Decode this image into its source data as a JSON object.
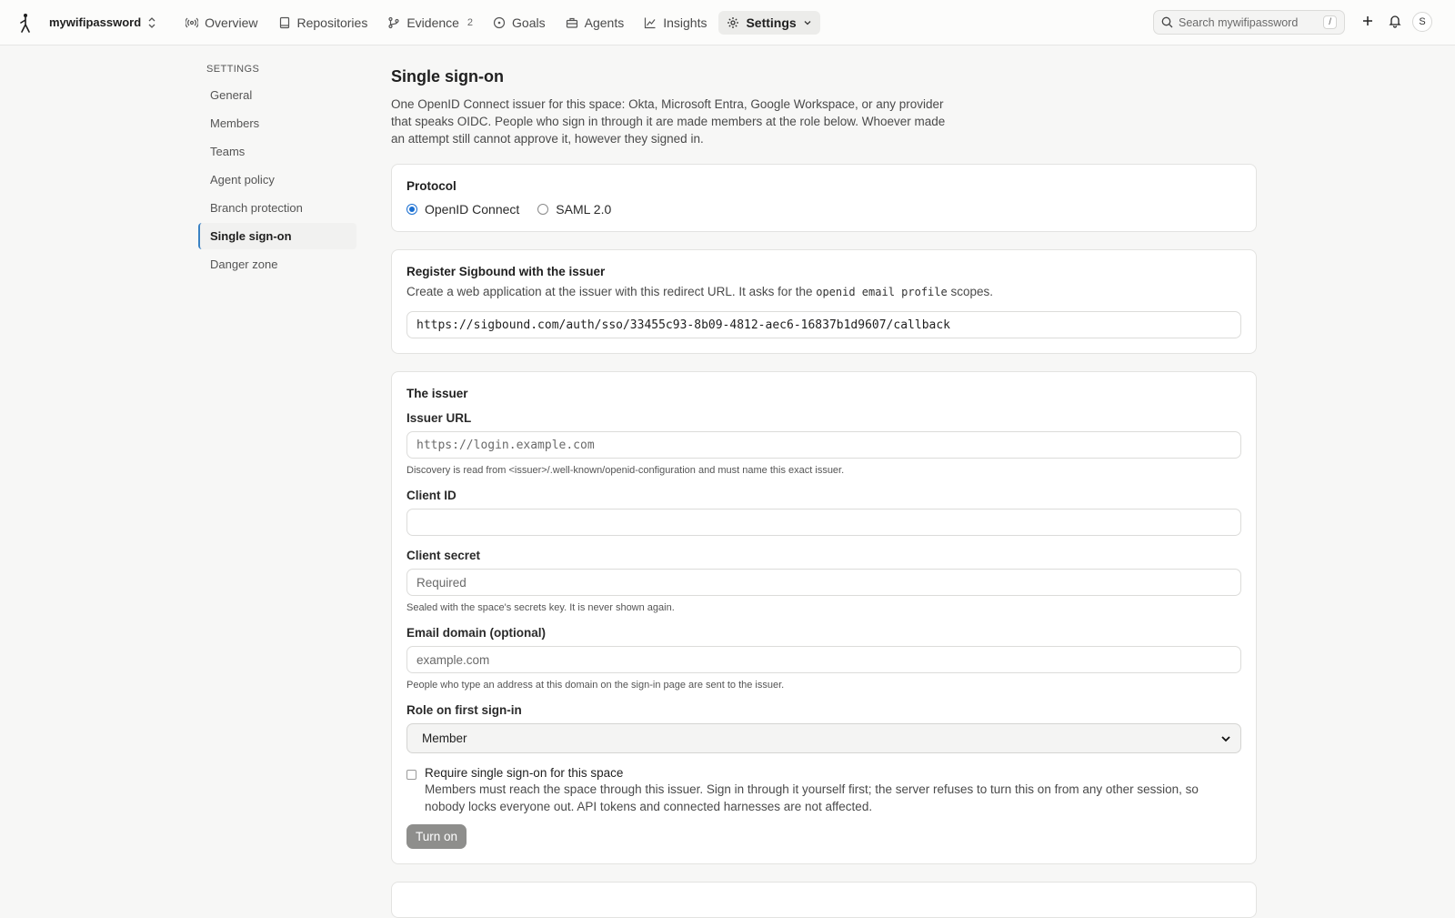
{
  "header": {
    "space_name": "mywifipassword",
    "nav": [
      {
        "label": "Overview",
        "icon": "broadcast-icon"
      },
      {
        "label": "Repositories",
        "icon": "book-icon"
      },
      {
        "label": "Evidence",
        "icon": "git-branch-icon",
        "count": "2"
      },
      {
        "label": "Goals",
        "icon": "target-icon"
      },
      {
        "label": "Agents",
        "icon": "briefcase-icon"
      },
      {
        "label": "Insights",
        "icon": "chart-line-icon"
      },
      {
        "label": "Settings",
        "icon": "gear-icon",
        "active": true
      }
    ],
    "search_placeholder": "Search mywifipassword",
    "search_shortcut": "/",
    "avatar_initial": "S"
  },
  "sidebar": {
    "heading": "Settings",
    "items": [
      {
        "label": "General"
      },
      {
        "label": "Members"
      },
      {
        "label": "Teams"
      },
      {
        "label": "Agent policy"
      },
      {
        "label": "Branch protection"
      },
      {
        "label": "Single sign-on",
        "active": true
      },
      {
        "label": "Danger zone"
      }
    ]
  },
  "main": {
    "title": "Single sign-on",
    "description": "One OpenID Connect issuer for this space: Okta, Microsoft Entra, Google Workspace, or any provider that speaks OIDC. People who sign in through it are made members at the role below. Whoever made an attempt still cannot approve it, however they signed in.",
    "protocol": {
      "title": "Protocol",
      "options": [
        "OpenID Connect",
        "SAML 2.0"
      ],
      "selected": "OpenID Connect"
    },
    "register": {
      "title": "Register Sigbound with the issuer",
      "desc_before": "Create a web application at the issuer with this redirect URL. It asks for the",
      "scopes": "openid email profile",
      "desc_after": "scopes.",
      "redirect_url": "https://sigbound.com/auth/sso/33455c93-8b09-4812-aec6-16837b1d9607/callback"
    },
    "issuer": {
      "title": "The issuer",
      "issuer_url_label": "Issuer URL",
      "issuer_url_placeholder": "https://login.example.com",
      "issuer_url_hint": "Discovery is read from <issuer>/.well-known/openid-configuration and must name this exact issuer.",
      "client_id_label": "Client ID",
      "client_id_value": "",
      "client_secret_label": "Client secret",
      "client_secret_placeholder": "Required",
      "client_secret_hint": "Sealed with the space's secrets key. It is never shown again.",
      "email_domain_label": "Email domain (optional)",
      "email_domain_placeholder": "example.com",
      "email_domain_hint": "People who type an address at this domain on the sign-in page are sent to the issuer.",
      "role_label": "Role on first sign-in",
      "role_value": "Member",
      "require_title": "Require single sign-on for this space",
      "require_desc": "Members must reach the space through this issuer. Sign in through it yourself first; the server refuses to turn this on from any other session, so nobody locks everyone out. API tokens and connected harnesses are not affected.",
      "require_checked": false,
      "turn_on_label": "Turn on"
    }
  }
}
